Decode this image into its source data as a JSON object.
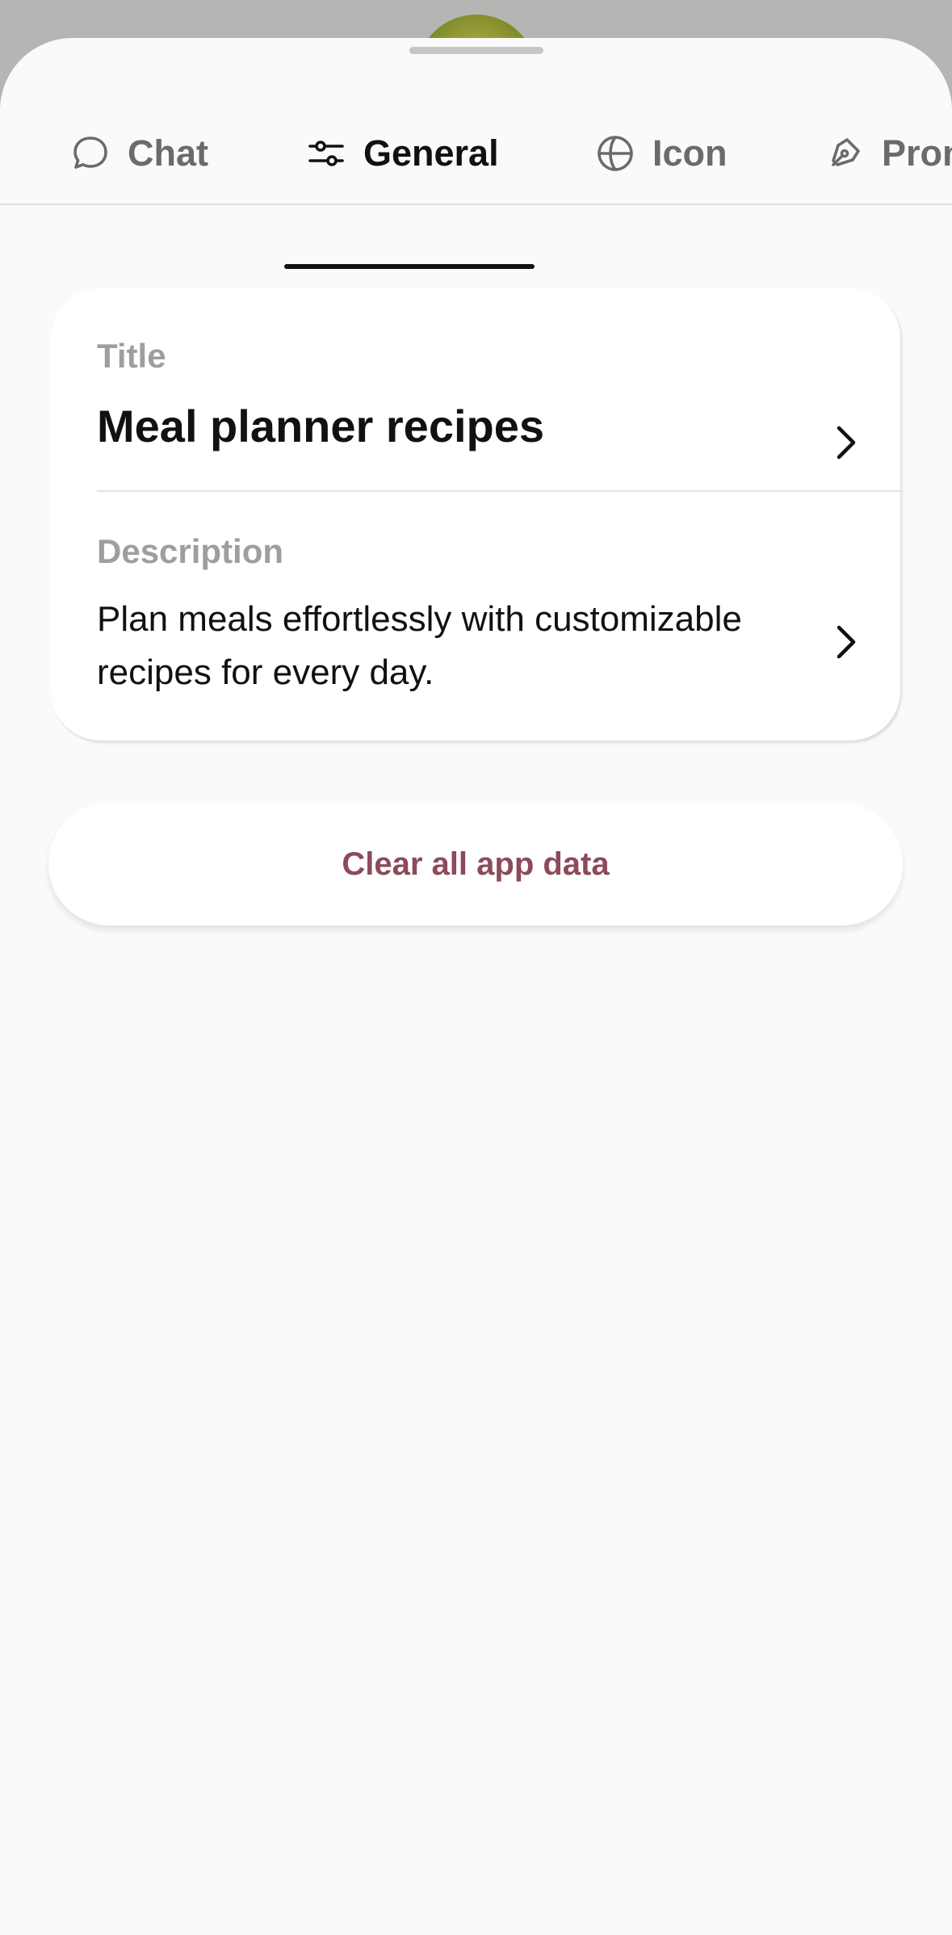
{
  "tabs": [
    {
      "label": "Chat",
      "icon": "chat-bubble-icon",
      "active": false
    },
    {
      "label": "General",
      "icon": "sliders-icon",
      "active": true
    },
    {
      "label": "Icon",
      "icon": "globe-icon",
      "active": false
    },
    {
      "label": "Pron",
      "icon": "pen-nib-icon",
      "active": false
    }
  ],
  "details": {
    "title_label": "Title",
    "title_value": "Meal planner recipes",
    "description_label": "Description",
    "description_value": "Plan meals effortlessly with customizable recipes for every day."
  },
  "actions": {
    "clear_label": "Clear all app data"
  },
  "colors": {
    "active_text": "#111111",
    "inactive_text": "#6b6b6b",
    "label_gray": "#9e9e9e",
    "danger_text": "#8c4a5a",
    "sheet_background": "#fafafa"
  }
}
